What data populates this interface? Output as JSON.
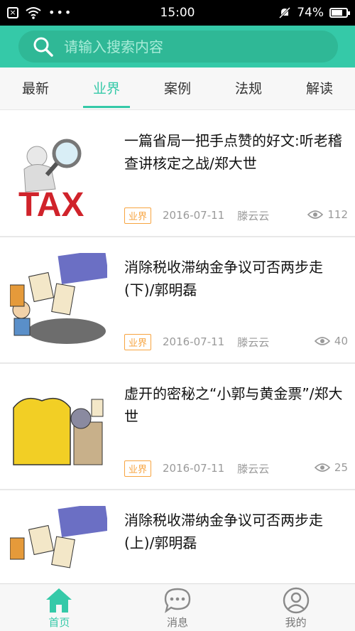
{
  "status_bar": {
    "time": "15:00",
    "battery": "74%",
    "battery_level": 0.74
  },
  "search": {
    "placeholder": "请输入搜索内容",
    "icon": "search-icon"
  },
  "tabs": [
    {
      "label": "最新",
      "active": false
    },
    {
      "label": "业界",
      "active": true
    },
    {
      "label": "案例",
      "active": false
    },
    {
      "label": "法规",
      "active": false
    },
    {
      "label": "解读",
      "active": false
    }
  ],
  "articles": [
    {
      "title": "一篇省局一把手点赞的好文:听老稽查讲核定之战/郑大世",
      "tag": "业界",
      "date": "2016-07-11",
      "author": "滕云云",
      "views": "112",
      "thumb": "tax-magnifier"
    },
    {
      "title": "消除税收滞纳金争议可否两步走(下)/郭明磊",
      "tag": "业界",
      "date": "2016-07-11",
      "author": "滕云云",
      "views": "40",
      "thumb": "penalty-cartoon"
    },
    {
      "title": "虚开的密秘之“小郭与黄金票”/郑大世",
      "tag": "业界",
      "date": "2016-07-11",
      "author": "滕云云",
      "views": "25",
      "thumb": "gold-trade-cartoon"
    },
    {
      "title": "消除税收滞纳金争议可否两步走(上)/郭明磊",
      "tag": "",
      "date": "",
      "author": "",
      "views": "",
      "thumb": "penalty-cartoon"
    }
  ],
  "bottom_nav": [
    {
      "label": "首页",
      "icon": "home-icon",
      "active": true
    },
    {
      "label": "消息",
      "icon": "message-icon",
      "active": false
    },
    {
      "label": "我的",
      "icon": "profile-icon",
      "active": false
    }
  ],
  "colors": {
    "accent": "#35c9a8",
    "tag": "#f7a440"
  }
}
